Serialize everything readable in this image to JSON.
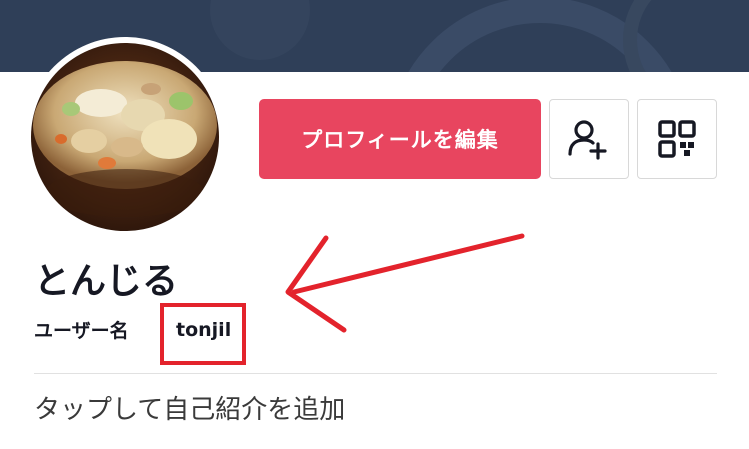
{
  "profile": {
    "display_name": "とんじる",
    "username_label": "ユーザー名",
    "username": "tonjil",
    "bio_placeholder": "タップして自己紹介を追加"
  },
  "actions": {
    "edit_profile_label": "プロフィールを編集",
    "add_friend_icon": "person-plus-icon",
    "qr_icon": "qr-code-icon"
  },
  "annotation": {
    "highlight_color": "#e3232c",
    "arrow_color": "#e3232c"
  },
  "colors": {
    "cover": "#2f3f58",
    "accent": "#e8455f",
    "text": "#161823"
  }
}
